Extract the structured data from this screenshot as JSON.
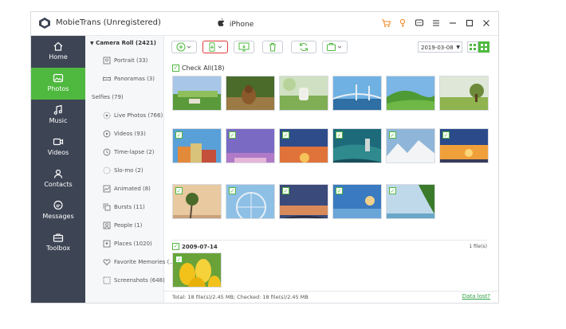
{
  "window": {
    "title": "MobieTrans (Unregistered)",
    "device": "iPhone"
  },
  "titlebar_icons": [
    "cart-icon",
    "key-icon",
    "feedback-icon",
    "menu-icon",
    "minimize-icon",
    "maximize-icon",
    "close-icon"
  ],
  "sidebar": {
    "items": [
      {
        "label": "Home",
        "icon": "home-icon",
        "active": false
      },
      {
        "label": "Photos",
        "icon": "photo-icon",
        "active": true
      },
      {
        "label": "Music",
        "icon": "music-icon",
        "active": false
      },
      {
        "label": "Videos",
        "icon": "video-icon",
        "active": false
      },
      {
        "label": "Contacts",
        "icon": "contacts-icon",
        "active": false
      },
      {
        "label": "Messages",
        "icon": "messages-icon",
        "active": false
      },
      {
        "label": "Toolbox",
        "icon": "toolbox-icon",
        "active": false
      }
    ]
  },
  "albums": {
    "header": "Camera Roll (2421)",
    "items": [
      {
        "label": "Portrait (33)",
        "icon": "portrait-icon"
      },
      {
        "label": "Panoramas (3)",
        "icon": "panorama-icon"
      },
      {
        "label": "Selfies (79)",
        "icon": ""
      },
      {
        "label": "Live Photos (766)",
        "icon": "live-photo-icon"
      },
      {
        "label": "Videos (93)",
        "icon": "video-icon"
      },
      {
        "label": "Time-lapse (2)",
        "icon": "time-lapse-icon"
      },
      {
        "label": "Slo-mo (2)",
        "icon": "slo-mo-icon"
      },
      {
        "label": "Animated (8)",
        "icon": "animated-icon"
      },
      {
        "label": "Bursts (11)",
        "icon": "bursts-icon"
      },
      {
        "label": "People (1)",
        "icon": "people-icon"
      },
      {
        "label": "Places (1020)",
        "icon": "places-icon"
      },
      {
        "label": "Favorite Memories (...",
        "icon": "heart-icon"
      },
      {
        "label": "Screenshots (648)",
        "icon": "screenshot-icon"
      }
    ]
  },
  "toolbar": {
    "date": "2019-03-08",
    "buttons": [
      "add-button",
      "export-to-device-button",
      "export-to-pc-button",
      "delete-button",
      "refresh-button",
      "toolkit-button"
    ]
  },
  "check_all_label": "Check All(18)",
  "groups": [
    {
      "date": "",
      "count": ""
    },
    {
      "date": "2009-07-14",
      "count": "1 file(s)"
    }
  ],
  "footer": {
    "summary": "Total: 18 file(s)/2.45 MB; Checked: 18 file(s)/2.45 MB",
    "link": "Data lost?"
  },
  "colors": {
    "accent": "#4fb83f",
    "sidebar": "#3d4554",
    "highlight": "#e03a3a"
  }
}
